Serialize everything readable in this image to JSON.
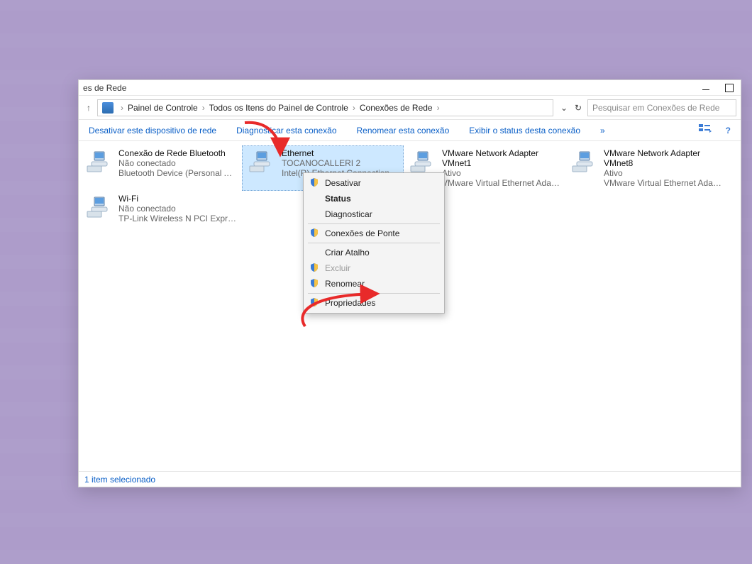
{
  "window": {
    "title_suffix": "es de Rede",
    "status_text": "1 item selecionado"
  },
  "breadcrumbs": [
    "Painel de Controle",
    "Todos os Itens do Painel de Controle",
    "Conexões de Rede"
  ],
  "search": {
    "placeholder": "Pesquisar em Conexões de Rede"
  },
  "commands": {
    "deactivate": "Desativar este dispositivo de rede",
    "diagnose": "Diagnosticar esta conexão",
    "rename": "Renomear esta conexão",
    "view_status": "Exibir o status desta conexão",
    "overflow": "»"
  },
  "adapters": [
    {
      "name": "Conexão de Rede Bluetooth",
      "status": "Não conectado",
      "desc": "Bluetooth Device (Personal Area ...",
      "selected": false
    },
    {
      "name": "Ethernet",
      "status": "TOCANOCALLERI 2",
      "desc": "Intel(R) Ethernet Connection ...",
      "selected": true
    },
    {
      "name": "VMware Network Adapter VMnet1",
      "status": "Ativo",
      "desc": "VMware Virtual Ethernet Adapter ...",
      "selected": false
    },
    {
      "name": "VMware Network Adapter VMnet8",
      "status": "Ativo",
      "desc": "VMware Virtual Ethernet Adapter ...",
      "selected": false
    },
    {
      "name": "Wi-Fi",
      "status": "Não conectado",
      "desc": "TP-Link Wireless N PCI Express A...",
      "selected": false
    }
  ],
  "context_menu": {
    "items": [
      {
        "label": "Desativar",
        "shield": true,
        "bold": false,
        "disabled": false
      },
      {
        "label": "Status",
        "shield": false,
        "bold": true,
        "disabled": false
      },
      {
        "label": "Diagnosticar",
        "shield": false,
        "bold": false,
        "disabled": false
      },
      {
        "sep": true
      },
      {
        "label": "Conexões de Ponte",
        "shield": true,
        "bold": false,
        "disabled": false
      },
      {
        "sep": true
      },
      {
        "label": "Criar Atalho",
        "shield": false,
        "bold": false,
        "disabled": false
      },
      {
        "label": "Excluir",
        "shield": true,
        "bold": false,
        "disabled": true
      },
      {
        "label": "Renomear",
        "shield": true,
        "bold": false,
        "disabled": false
      },
      {
        "sep": true
      },
      {
        "label": "Propriedades",
        "shield": true,
        "bold": false,
        "disabled": false
      }
    ]
  },
  "annotation_color": "#e82a2a"
}
